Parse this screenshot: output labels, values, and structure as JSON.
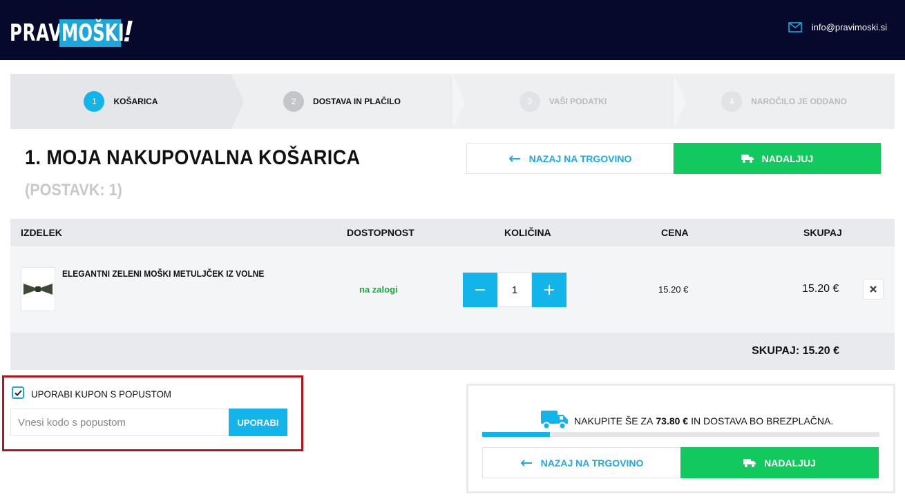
{
  "header": {
    "logo_pravi": "PRAVI",
    "logo_moski": "MOŠKI",
    "logo_excl": "!",
    "email": "info@pravimoski.si"
  },
  "steps": [
    {
      "num": "1",
      "label": "KOŠARICA",
      "state": "active",
      "num_color": "#11b5ea",
      "label_color": "#111111"
    },
    {
      "num": "2",
      "label": "DOSTAVA IN PLAČILO",
      "state": "next",
      "num_color": "#c3c5c9",
      "label_color": "#111111"
    },
    {
      "num": "3",
      "label": "VAŠI PODATKI",
      "state": "future",
      "num_color": "#e1e3e6",
      "label_color": "#b8babe"
    },
    {
      "num": "4",
      "label": "NAROČILO JE ODDANO",
      "state": "future",
      "num_color": "#e1e3e6",
      "label_color": "#b8babe"
    }
  ],
  "cart": {
    "title": "1. MOJA NAKUPOVALNA KOŠARICA",
    "subtitle": "(POSTAVK: 1)",
    "back_label": "NAZAJ NA TRGOVINO",
    "next_label": "NADALJUJ"
  },
  "table": {
    "headers": [
      "IZDELEK",
      "DOSTOPNOST",
      "KOLIČINA",
      "CENA",
      "SKUPAJ"
    ],
    "rows": [
      {
        "name": "ELEGANTNI ZELENI MOŠKI METULJČEK IZ VOLNE",
        "availability": "na zalogi",
        "quantity": "1",
        "price": "15.20 €",
        "total": "15.20 €"
      }
    ],
    "sum": "SKUPAJ: 15.20 €"
  },
  "coupon": {
    "checked": true,
    "label": "UPORABI KUPON S POPUSTOM",
    "placeholder": "Vnesi kodo s popustom",
    "button": "UPORABI"
  },
  "shipping": {
    "text_before": "NAKUPITE ŠE ZA",
    "amount": "73.80 €",
    "text_after": "IN DOSTAVA BO BREZPLAČNA.",
    "progress": 0.17,
    "back_label": "NAZAJ NA TRGOVINO",
    "next_label": "NADALJUJ"
  },
  "colors": {
    "header_bg": "#06092b",
    "accent": "#11b5ea",
    "success": "#11c95d",
    "highlight_border": "#b3141b"
  }
}
